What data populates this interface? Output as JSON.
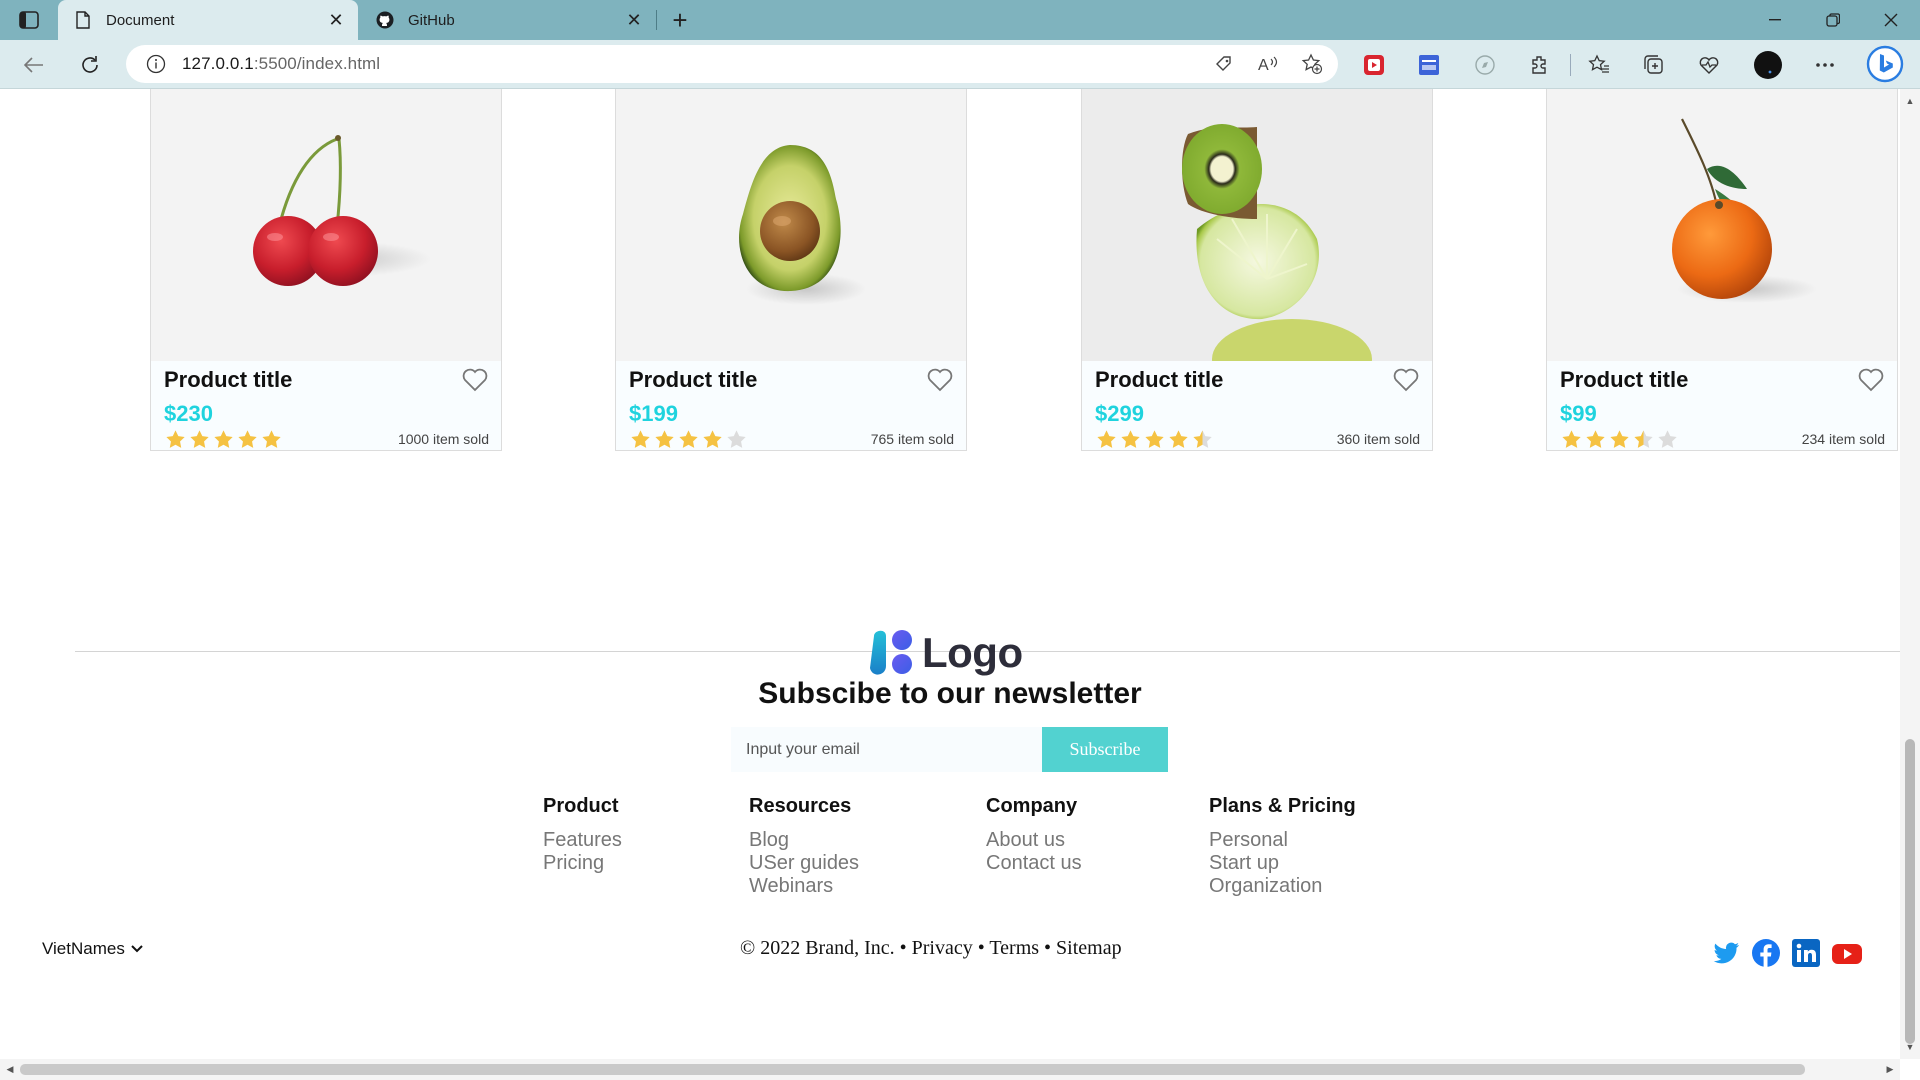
{
  "browser": {
    "tabs": [
      {
        "title": "Document",
        "icon": "document-icon",
        "active": true
      },
      {
        "title": "GitHub",
        "icon": "github-icon",
        "active": false
      }
    ],
    "url_host": "127.0.0.1",
    "url_path": ":5500/index.html"
  },
  "products": [
    {
      "title": "Product title",
      "price": "$230",
      "rating": 5,
      "sold": "1000 item sold",
      "image": "cherry"
    },
    {
      "title": "Product title",
      "price": "$199",
      "rating": 4,
      "sold": "765 item sold",
      "image": "avocado"
    },
    {
      "title": "Product title",
      "price": "$299",
      "rating": 4.5,
      "sold": "360 item sold",
      "image": "kiwi-lime"
    },
    {
      "title": "Product title",
      "price": "$99",
      "rating": 3.5,
      "sold": "234 item sold",
      "image": "tangerine"
    }
  ],
  "footer": {
    "logo_text": "Logo",
    "newsletter_title": "Subscibe to our newsletter",
    "email_placeholder": "Input your email",
    "subscribe_label": "Subscribe",
    "columns": [
      {
        "heading": "Product",
        "links": [
          "Features",
          "Pricing"
        ]
      },
      {
        "heading": "Resources",
        "links": [
          "Blog",
          "USer guides",
          "Webinars"
        ]
      },
      {
        "heading": "Company",
        "links": [
          "About us",
          "Contact us"
        ]
      },
      {
        "heading": "Plans & Pricing",
        "links": [
          "Personal",
          "Start up",
          "Organization"
        ]
      }
    ],
    "language": "VietNames",
    "copyright": "© 2022 Brand, Inc. • Privacy • Terms • Sitemap",
    "social": [
      "twitter-icon",
      "facebook-icon",
      "linkedin-icon",
      "youtube-icon"
    ]
  },
  "colors": {
    "price": "#1fd3de",
    "star": "#f5c242",
    "subscribe": "#52d2d0",
    "chrome": "#7fb3be"
  }
}
